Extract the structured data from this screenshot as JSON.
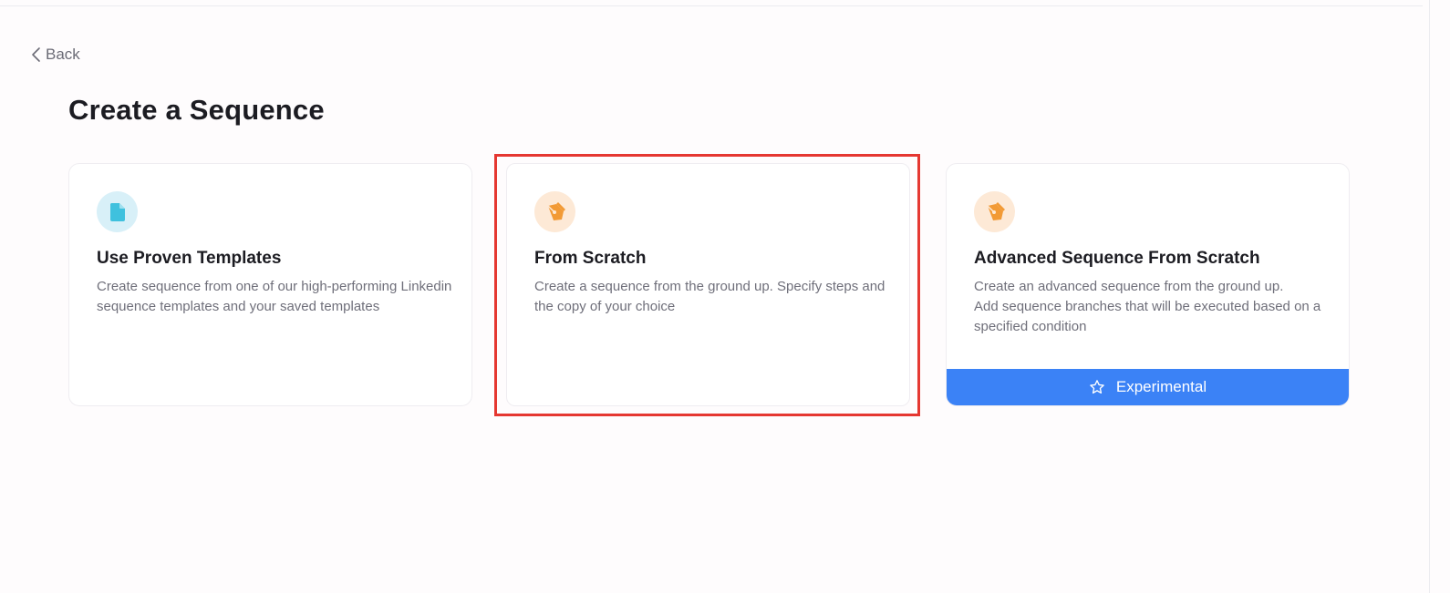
{
  "nav": {
    "back_label": "Back"
  },
  "page": {
    "title": "Create a Sequence"
  },
  "cards": {
    "templates": {
      "icon": "document-icon",
      "title": "Use Proven Templates",
      "description": "Create sequence from one of our high-performing Linkedin sequence templates and your saved templates"
    },
    "scratch": {
      "icon": "pen-nib-icon",
      "title": "From Scratch",
      "description": "Create a sequence from the ground up. Specify steps and the copy of your choice",
      "highlighted": true
    },
    "advanced": {
      "icon": "pen-nib-icon",
      "title": "Advanced Sequence From Scratch",
      "description_line1": "Create an advanced sequence from the ground up.",
      "description_line2": "Add sequence branches that will be executed based on a specified condition",
      "badge_label": "Experimental",
      "badge_icon": "star-icon"
    }
  },
  "colors": {
    "accent_blue": "#3b82f6",
    "icon_teal": "#3fc1de",
    "icon_orange": "#f29a35",
    "highlight_red": "#e53731",
    "title_text": "#1c1c22",
    "body_text": "#6f6f7a"
  }
}
